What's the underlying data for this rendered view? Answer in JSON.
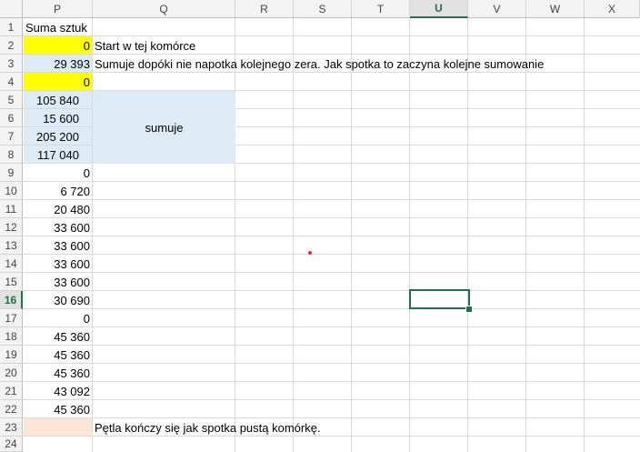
{
  "columns": [
    "P",
    "Q",
    "R",
    "S",
    "T",
    "U",
    "V",
    "W",
    "X"
  ],
  "active_column": "U",
  "rows": [
    "1",
    "2",
    "3",
    "4",
    "5",
    "6",
    "7",
    "8",
    "9",
    "10",
    "11",
    "12",
    "13",
    "14",
    "15",
    "16",
    "17",
    "18",
    "19",
    "20",
    "21",
    "22",
    "23",
    "24"
  ],
  "active_row": "16",
  "cells": {
    "p1": "Suma sztuk",
    "p2": "0",
    "q2": "Start w tej komórce",
    "p3": "29 393",
    "q3": "Sumuje dopóki nie napotka kolejnego zera. Jak spotka to zaczyna kolejne sumowanie",
    "p4": "0",
    "p5": "105 840",
    "p6": "15 600",
    "p7": "205 200",
    "p8": "117 040",
    "q5_merged": "sumuje",
    "p9": "0",
    "p10": "6 720",
    "p11": "20 480",
    "p12": "33 600",
    "p13": "33 600",
    "p14": "33 600",
    "p15": "33 600",
    "p16": "30 690",
    "p17": "0",
    "p18": "45 360",
    "p19": "45 360",
    "p20": "45 360",
    "p21": "43 092",
    "p22": "45 360",
    "q23": "Pętla kończy się jak spotka pustą komórkę."
  },
  "colors": {
    "yellow": "#ffff00",
    "blue": "#ddebf7",
    "peach": "#fce4d6",
    "selection": "#217346"
  }
}
